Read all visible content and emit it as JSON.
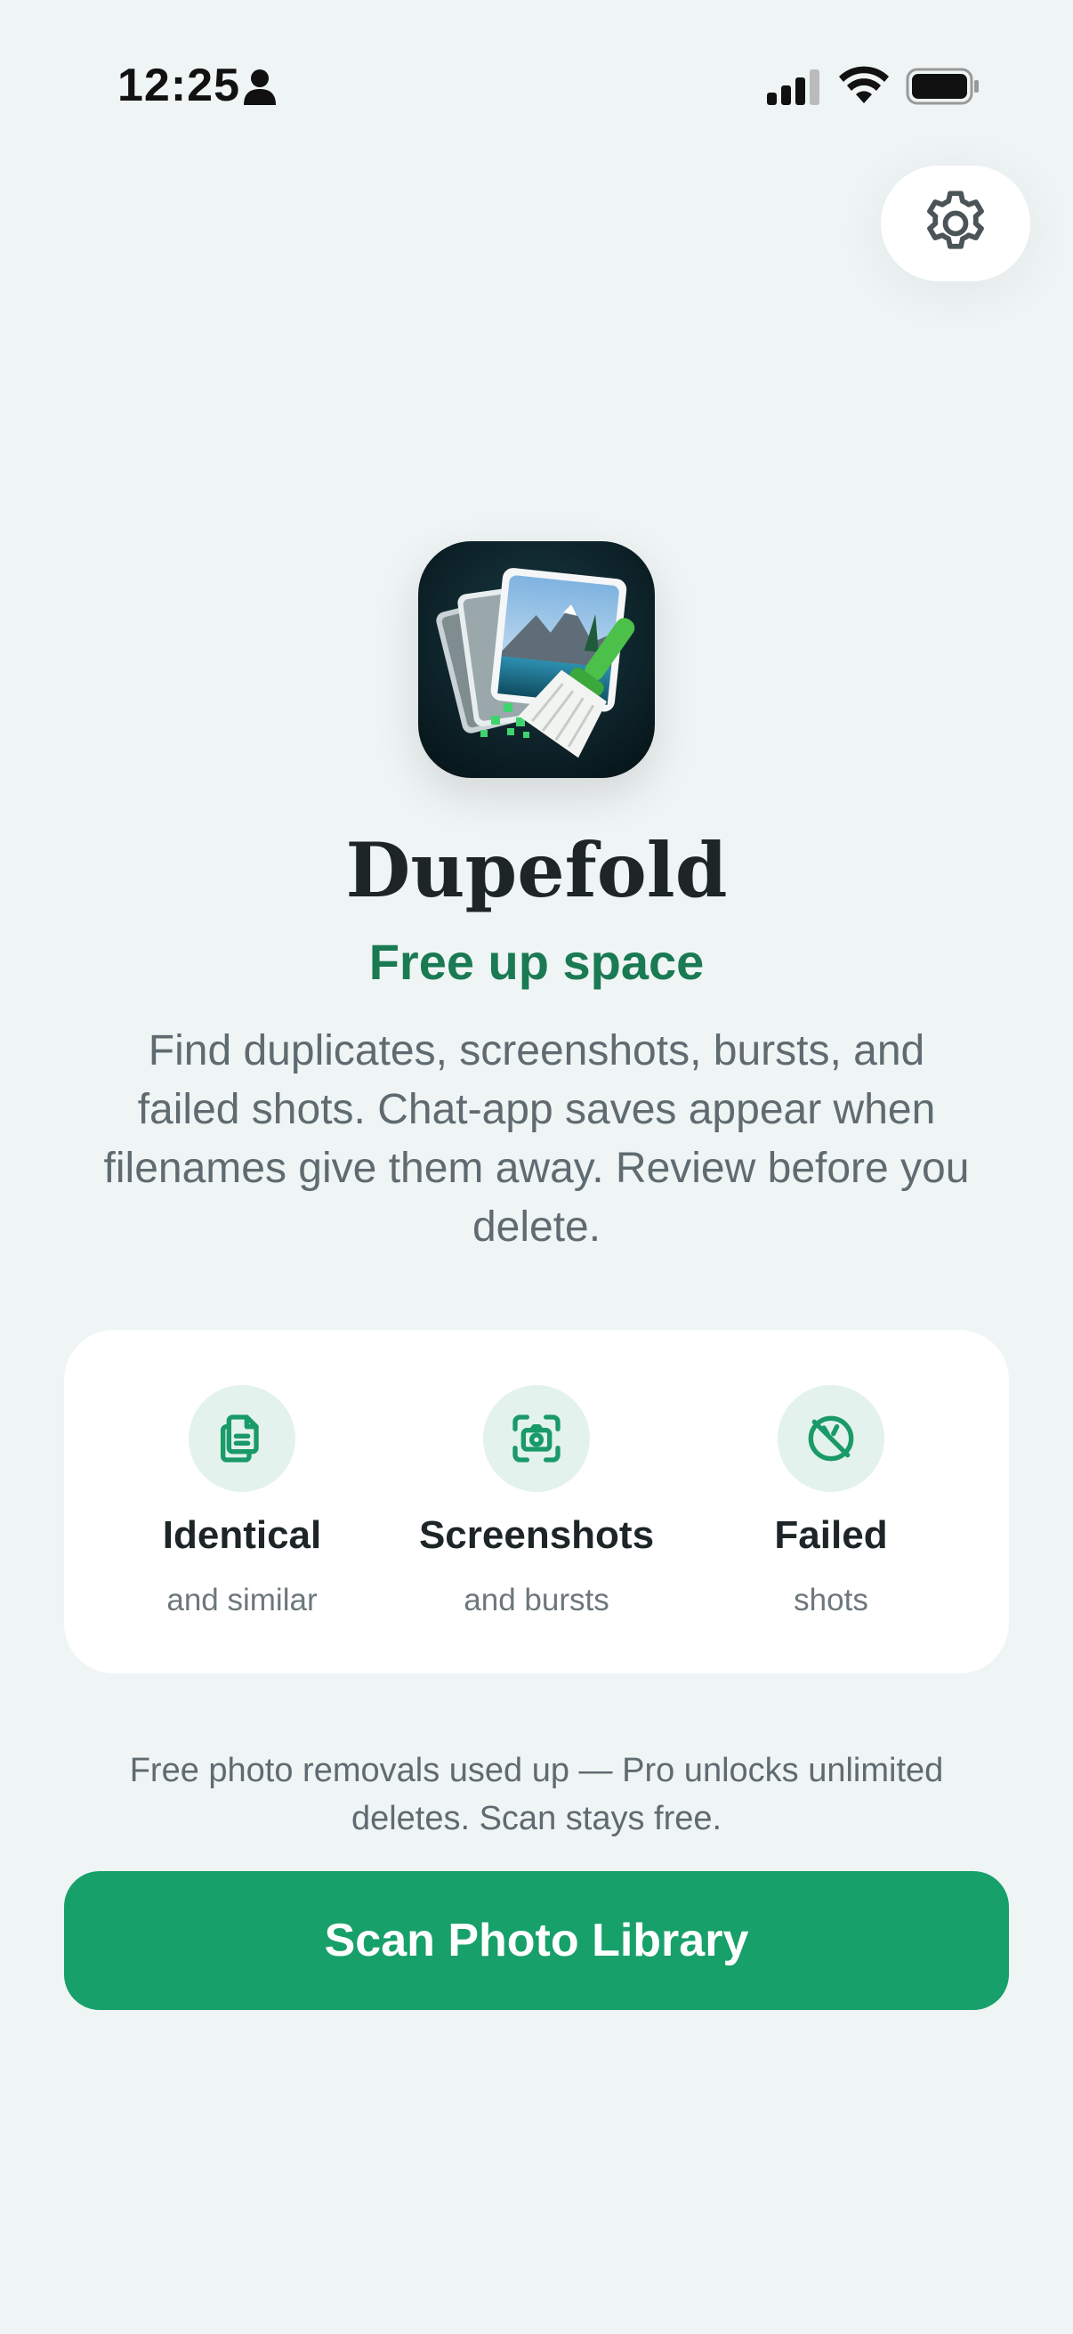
{
  "status_bar": {
    "time": "12:25",
    "icons": [
      "person-icon",
      "cellular-signal-icon",
      "wifi-icon",
      "battery-icon"
    ]
  },
  "header": {
    "settings_icon": "gear-icon"
  },
  "hero": {
    "app_icon": "app-icon-photos-broom",
    "title": "Dupefold",
    "tagline": "Free up space",
    "description": "Find duplicates, screenshots, bursts, and failed shots. Chat-app saves appear when filenames give them away. Review before you delete."
  },
  "features": [
    {
      "icon": "duplicate-files-icon",
      "title": "Identical",
      "subtitle": "and similar"
    },
    {
      "icon": "screenshot-camera-icon",
      "title": "Screenshots",
      "subtitle": "and bursts"
    },
    {
      "icon": "failed-shot-icon",
      "title": "Failed",
      "subtitle": "shots"
    }
  ],
  "notice": "Free photo removals used up — Pro unlocks unlimited deletes. Scan stays free.",
  "primary_action": {
    "label": "Scan Photo Library"
  },
  "colors": {
    "background": "#eff4f4",
    "accent": "#17a069",
    "tagline": "#1a7a53",
    "icon_circle": "#e3f2ec"
  }
}
